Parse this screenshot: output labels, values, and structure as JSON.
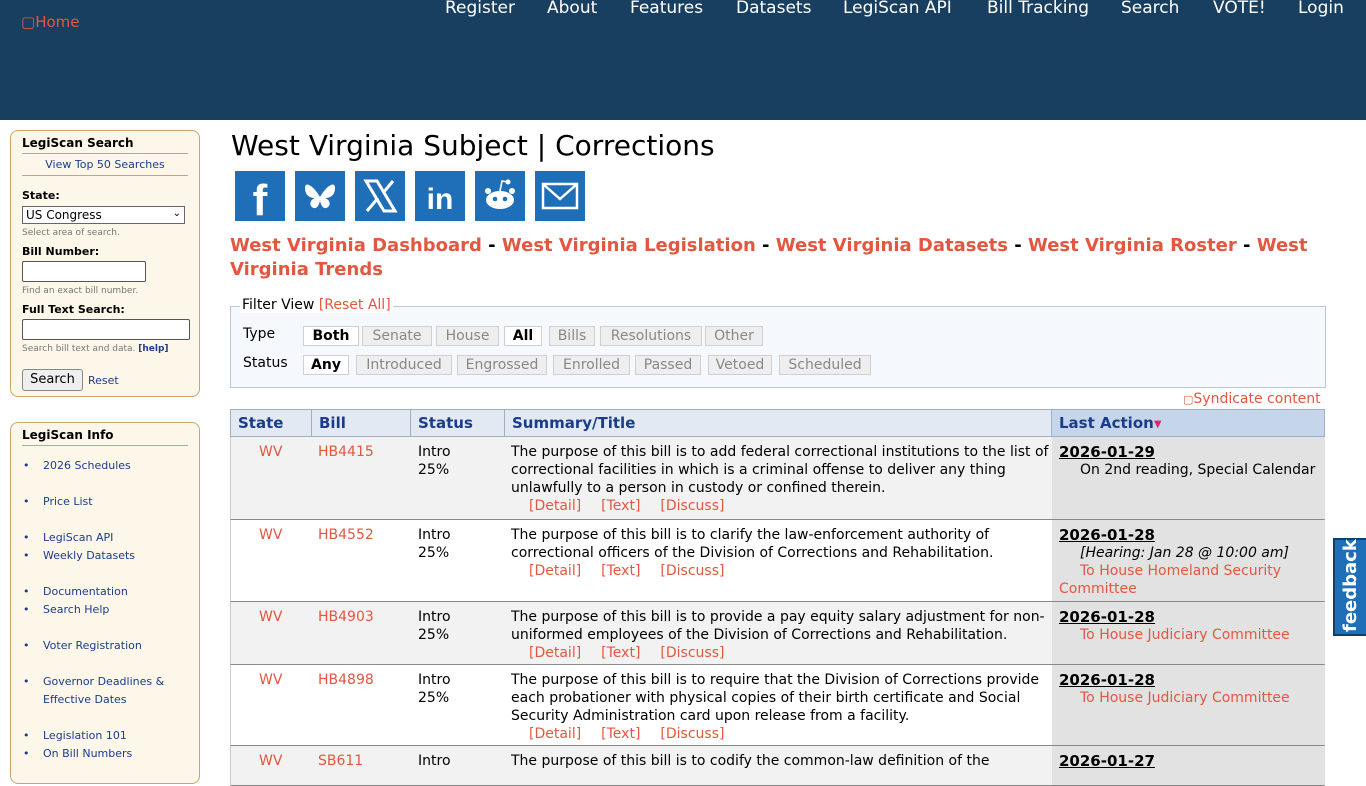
{
  "header": {
    "home_alt": "Home",
    "nav": [
      "Register",
      "About",
      "Features",
      "Datasets",
      "LegiScan API",
      "Bill Tracking",
      "Search",
      "VOTE!",
      "Login"
    ]
  },
  "sidebar_search": {
    "title": "LegiScan Search",
    "top50": "View Top 50 Searches",
    "state_label": "State:",
    "state_value": "US Congress",
    "state_hint": "Select area of search.",
    "bill_label": "Bill Number:",
    "bill_hint": "Find an exact bill number.",
    "fulltext_label": "Full Text Search:",
    "fulltext_hint": "Search bill text and data.",
    "help": "[help]",
    "search_button": "Search",
    "reset": "Reset"
  },
  "sidebar_info": {
    "title": "LegiScan Info",
    "groups": [
      [
        "2026 Schedules"
      ],
      [
        "Price List"
      ],
      [
        "LegiScan API",
        "Weekly Datasets"
      ],
      [
        "Documentation",
        "Search Help"
      ],
      [
        "Voter Registration"
      ],
      [
        "Governor Deadlines & Effective Dates"
      ],
      [
        "Legislation 101",
        "On Bill Numbers"
      ]
    ]
  },
  "page": {
    "title": "West Virginia Subject | Corrections",
    "social": [
      "facebook-icon",
      "bluesky-icon",
      "x-icon",
      "linkedin-icon",
      "reddit-icon",
      "email-icon"
    ],
    "crumbs": [
      "West Virginia Dashboard",
      "West Virginia Legislation",
      "West Virginia Datasets",
      "West Virginia Roster",
      "West Virginia Trends"
    ],
    "crumb_sep": "-"
  },
  "filter": {
    "legend": "Filter View",
    "reset_all": "[Reset All]",
    "type_label": "Type",
    "status_label": "Status",
    "type_chips": [
      "Both",
      "Senate",
      "House",
      "All",
      "Bills",
      "Resolutions",
      "Other"
    ],
    "type_active": [
      "Both",
      "All"
    ],
    "status_chips": [
      "Any",
      "Introduced",
      "Engrossed",
      "Enrolled",
      "Passed",
      "Vetoed",
      "Scheduled"
    ],
    "status_active": [
      "Any"
    ]
  },
  "syndicate": "Syndicate content",
  "table": {
    "headers": {
      "state": "State",
      "bill": "Bill",
      "status": "Status",
      "summary": "Summary/Title",
      "last_action": "Last Action"
    },
    "link_labels": [
      "[Detail]",
      "[Text]",
      "[Discuss]"
    ],
    "rows": [
      {
        "state": "WV",
        "bill": "HB4415",
        "status": "Intro",
        "progress": "25%",
        "summary": "The purpose of this bill is to add federal correctional institutions to the list of correctional facilities in which is a criminal offense to deliver any thing unlawfully to a person in custody or confined therein.",
        "date": "2026-01-29",
        "hearing": "",
        "action": "On 2nd reading, Special Calendar",
        "action_is_link": false
      },
      {
        "state": "WV",
        "bill": "HB4552",
        "status": "Intro",
        "progress": "25%",
        "summary": "The purpose of this bill is to clarify the law-enforcement authority of correctional officers of the Division of Corrections and Rehabilitation.",
        "date": "2026-01-28",
        "hearing": "[Hearing: Jan 28 @ 10:00 am]",
        "action": "To House Homeland Security Committee",
        "action_is_link": true
      },
      {
        "state": "WV",
        "bill": "HB4903",
        "status": "Intro",
        "progress": "25%",
        "summary": "The purpose of this bill is to provide a pay equity salary adjustment for non-uniformed employees of the Division of Corrections and Rehabilitation.",
        "date": "2026-01-28",
        "hearing": "",
        "action": "To House Judiciary Committee",
        "action_is_link": true
      },
      {
        "state": "WV",
        "bill": "HB4898",
        "status": "Intro",
        "progress": "25%",
        "summary": "The purpose of this bill is to require that the Division of Corrections provide each probationer with physical copies of their birth certificate and Social Security Administration card upon release from a facility.",
        "date": "2026-01-28",
        "hearing": "",
        "action": "To House Judiciary Committee",
        "action_is_link": true
      },
      {
        "state": "WV",
        "bill": "SB611",
        "status": "Intro",
        "progress": "",
        "summary": "The purpose of this bill is to codify the common-law definition of the",
        "date": "2026-01-27",
        "hearing": "",
        "action": "",
        "action_is_link": false
      }
    ]
  },
  "feedback": "feedback"
}
